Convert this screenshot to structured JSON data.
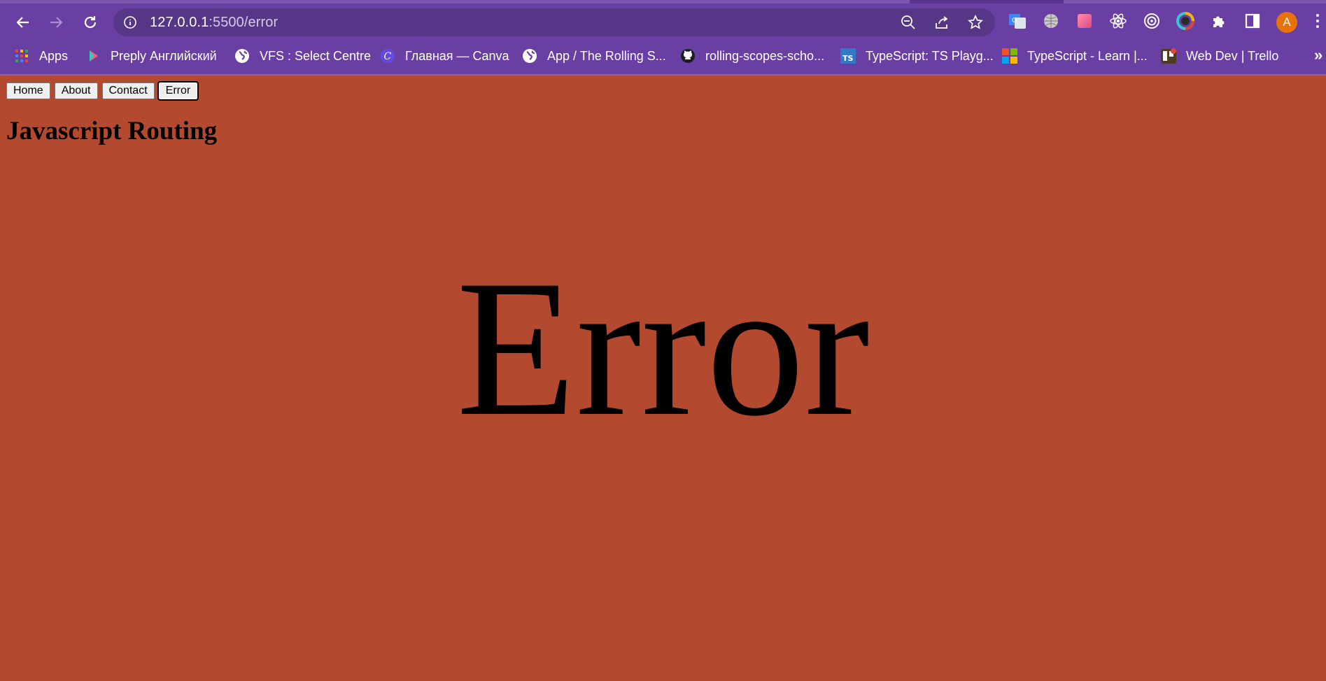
{
  "browser": {
    "url_host": "127.0.0.1",
    "url_path": ":5500/error",
    "avatar_letter": "A",
    "bookmarks": [
      {
        "label": "Apps",
        "icon": "apps-grid-icon"
      },
      {
        "label": "Preply Английский",
        "icon": "preply-icon"
      },
      {
        "label": "VFS : Select Centre",
        "icon": "globe-icon"
      },
      {
        "label": "Главная — Canva",
        "icon": "canva-icon"
      },
      {
        "label": "App / The Rolling S...",
        "icon": "globe-icon"
      },
      {
        "label": "rolling-scopes-scho...",
        "icon": "github-icon"
      },
      {
        "label": "TypeScript: TS Playg...",
        "icon": "typescript-icon"
      },
      {
        "label": "TypeScript - Learn |...",
        "icon": "microsoft-icon"
      },
      {
        "label": "Web Dev | Trello",
        "icon": "trello-icon"
      }
    ],
    "colors": {
      "chrome": "#6a3fa3",
      "omnibox": "#563686"
    }
  },
  "page": {
    "nav_buttons": [
      "Home",
      "About",
      "Contact",
      "Error"
    ],
    "active_button": "Error",
    "title": "Javascript Routing",
    "content": "Error",
    "background": "#b3492e"
  }
}
